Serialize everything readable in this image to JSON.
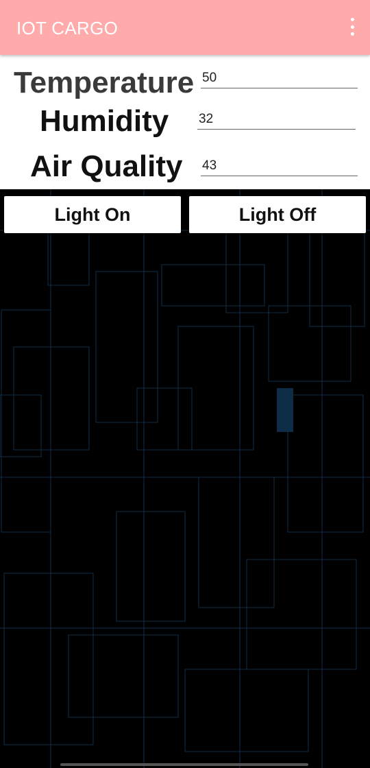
{
  "app": {
    "title": "IOT CARGO",
    "accent_color": "#ffabab",
    "overflow_icon": "more-vert-icon"
  },
  "sensors": {
    "temperature": {
      "label": "Temperature",
      "value": "50"
    },
    "humidity": {
      "label": "Humidity",
      "value": "32"
    },
    "air_quality": {
      "label": "Air Quality",
      "value": "43"
    }
  },
  "controls": {
    "light_on_label": "Light On",
    "light_off_label": "Light Off"
  },
  "background": {
    "base_color": "#000000",
    "line_color": "#1a6fb0"
  }
}
